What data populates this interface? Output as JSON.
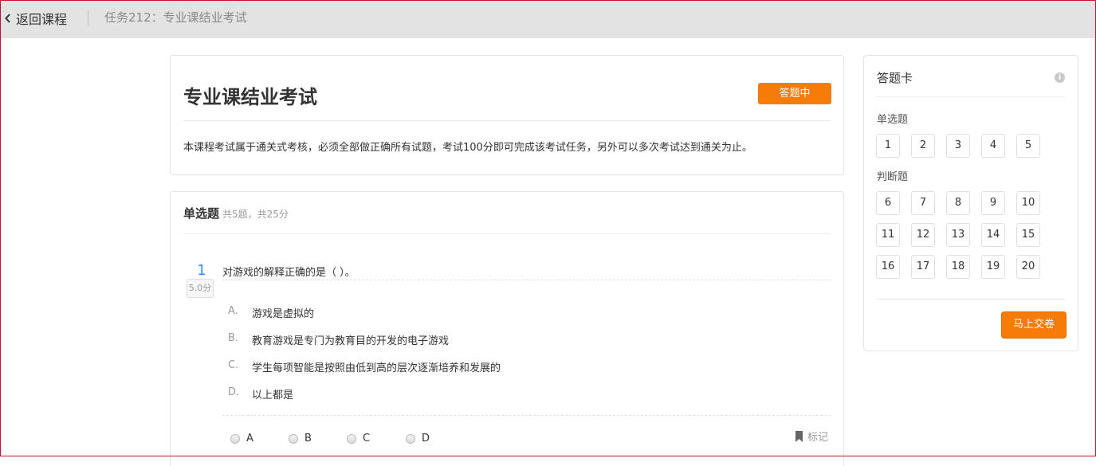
{
  "topbar": {
    "back_label": "返回课程",
    "task_title": "任务212：专业课结业考试"
  },
  "exam": {
    "title": "专业课结业考试",
    "status": "答题中",
    "description": "本课程考试属于通关式考核，必须全部做正确所有试题，考试100分即可完成该考试任务，另外可以多次考试达到通关为止。"
  },
  "section": {
    "name": "单选题",
    "meta": "共5题，共25分"
  },
  "question": {
    "number": "1",
    "score": "5.0分",
    "stem": "对游戏的解释正确的是（  ）。",
    "options": [
      {
        "letter": "A.",
        "text": "游戏是虚拟的"
      },
      {
        "letter": "B.",
        "text": "教育游戏是专门为教育目的开发的电子游戏"
      },
      {
        "letter": "C.",
        "text": "学生每项智能是按照由低到高的层次逐渐培养和发展的"
      },
      {
        "letter": "D.",
        "text": "以上都是"
      }
    ],
    "choices": [
      "A",
      "B",
      "C",
      "D"
    ],
    "mark_label": "标记"
  },
  "card": {
    "title": "答题卡",
    "info_icon": "i",
    "group1_label": "单选题",
    "group1": [
      "1",
      "2",
      "3",
      "4",
      "5"
    ],
    "group2_label": "判断题",
    "group2": [
      "6",
      "7",
      "8",
      "9",
      "10",
      "11",
      "12",
      "13",
      "14",
      "15",
      "16",
      "17",
      "18",
      "19",
      "20"
    ],
    "submit_label": "马上交卷"
  },
  "colors": {
    "accent": "#f77b09",
    "question_number": "#3a8ee6",
    "topbar_bg": "#e3e3e3"
  }
}
